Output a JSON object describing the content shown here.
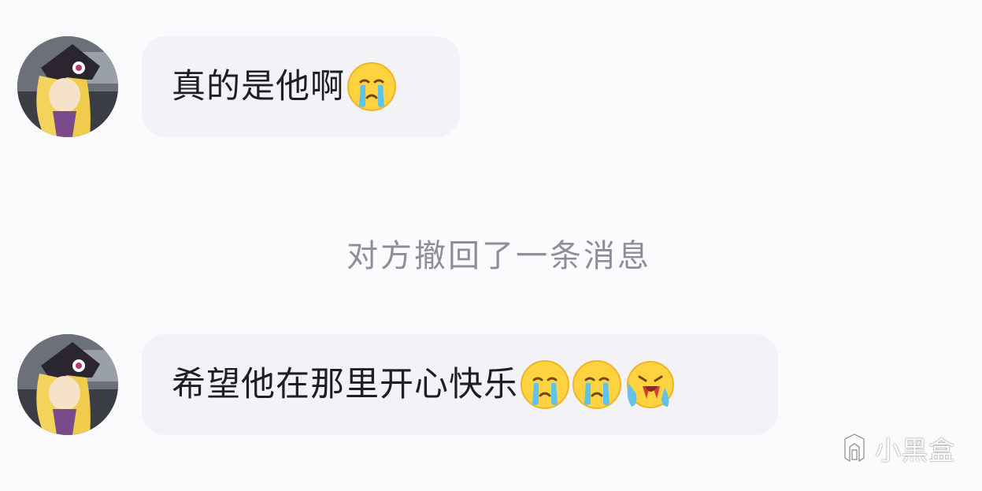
{
  "messages": [
    {
      "text": "真的是他啊",
      "emojis": [
        "crying-face"
      ]
    },
    {
      "text": "希望他在那里开心快乐",
      "emojis": [
        "crying-face",
        "crying-face",
        "loudly-crying-face"
      ]
    }
  ],
  "system_notice": "对方撤回了一条消息",
  "watermark": {
    "text": "小黑盒",
    "icon": "xiaoheihe-logo-icon"
  },
  "colors": {
    "background": "#fbfbfe",
    "bubble": "#f3f2f6",
    "text": "#1e1f24",
    "notice_text": "#8e8d98",
    "emoji_yellow": "#ffd23f",
    "emoji_tear": "#5fc3ec"
  }
}
